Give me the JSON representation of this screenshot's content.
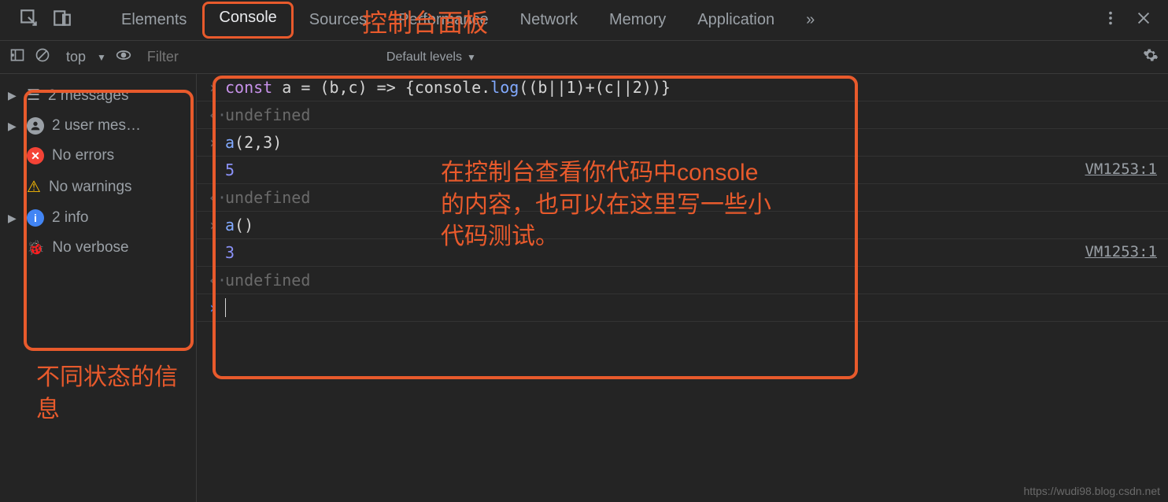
{
  "tabs": {
    "elements": "Elements",
    "console": "Console",
    "sources": "Sources",
    "performance": "Performance",
    "network": "Network",
    "memory": "Memory",
    "application": "Application"
  },
  "toolbar": {
    "context": "top",
    "filter_placeholder": "Filter",
    "levels": "Default levels"
  },
  "sidebar": {
    "messages": "2 messages",
    "user_messages": "2 user mes…",
    "no_errors": "No errors",
    "no_warnings": "No warnings",
    "info": "2 info",
    "no_verbose": "No verbose"
  },
  "console": {
    "line1_code": {
      "const": "const",
      "rest": " a = (b,c) => {console.",
      "log": "log",
      "after": "((b||1)+(c||2))}"
    },
    "undefined_text": "undefined",
    "line3": "a(2,3)",
    "line3_name": "a",
    "line3_args": "(2,3)",
    "result5": "5",
    "line6": "a()",
    "line6_name": "a",
    "line6_args": "()",
    "result3": "3",
    "source_link": "VM1253:1"
  },
  "annotations": {
    "top_label": "控制台面板",
    "sidebar_label": "不同状态的信息",
    "console_label": "在控制台查看你代码中console的内容，也可以在这里写一些小代码测试。"
  },
  "watermark": "https://wudi98.blog.csdn.net"
}
